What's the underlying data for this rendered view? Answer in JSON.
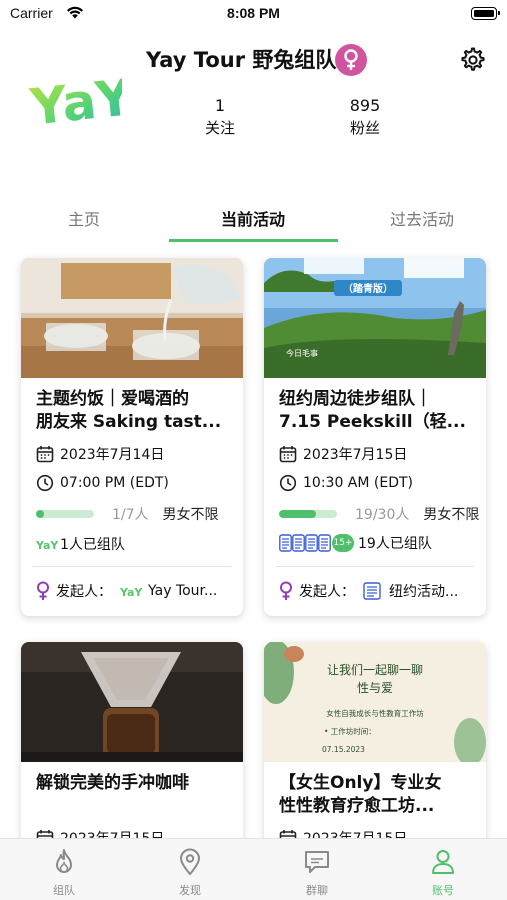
{
  "status_bar": {
    "carrier": "Carrier",
    "time": "8:08 PM"
  },
  "profile": {
    "name": "Yay Tour 野兔组队",
    "logo_text": "YaY!",
    "following_count": "1",
    "following_label": "关注",
    "fans_count": "895",
    "fans_label": "粉丝"
  },
  "tabs": [
    {
      "label": "主页",
      "active": false
    },
    {
      "label": "当前活动",
      "active": true
    },
    {
      "label": "过去活动",
      "active": false
    }
  ],
  "cards": [
    {
      "title_line1": "主题约饭｜爱喝酒的",
      "title_line2": "朋友来 Saking tast...",
      "date": "2023年7月14日",
      "time": "07:00 PM (EDT)",
      "progress": 0.14,
      "count": "1/7人",
      "gender": "男女不限",
      "joined": "1人已组队",
      "organizer_label": "发起人：",
      "organizer_name": "Yay Tour..."
    },
    {
      "title_line1": "纽约周边徒步组队｜",
      "title_line2": "7.15 Peekskill（轻...",
      "image_text_badge": "（踏青版）",
      "image_text_small": "今日毛事",
      "date": "2023年7月15日",
      "time": "10:30 AM (EDT)",
      "progress": 0.63,
      "count": "19/30人",
      "gender": "男女不限",
      "extra_badge": "15+",
      "joined": "19人已组队",
      "organizer_label": "发起人：",
      "organizer_name": "纽约活动..."
    },
    {
      "title_line1": "解锁完美的手冲咖啡",
      "date": "2023年7月15日"
    },
    {
      "title_line1": "【女生Only】专业女",
      "title_line2": "性性教育疗愈工坊...",
      "poster_heading_1": "让我们一起聊一聊",
      "poster_heading_2": "性与爱",
      "poster_subtitle": "女性自我成长与性教育工作坊",
      "poster_time_label": "• 工作坊时间：",
      "poster_date": "07.15.2023",
      "date": "2023年7月15日"
    }
  ],
  "bottom_nav": [
    {
      "label": "组队",
      "icon": "flame-icon",
      "active": false
    },
    {
      "label": "发现",
      "icon": "location-pin-icon",
      "active": false
    },
    {
      "label": "群聊",
      "icon": "chat-bubble-icon",
      "active": false
    },
    {
      "label": "账号",
      "icon": "person-icon",
      "active": true
    }
  ],
  "colors": {
    "accent": "#4fbf6b",
    "gender_female": "#d1559e",
    "organizer_icon": "#8e3fb5",
    "blue_avatar": "#3c5fd6"
  }
}
